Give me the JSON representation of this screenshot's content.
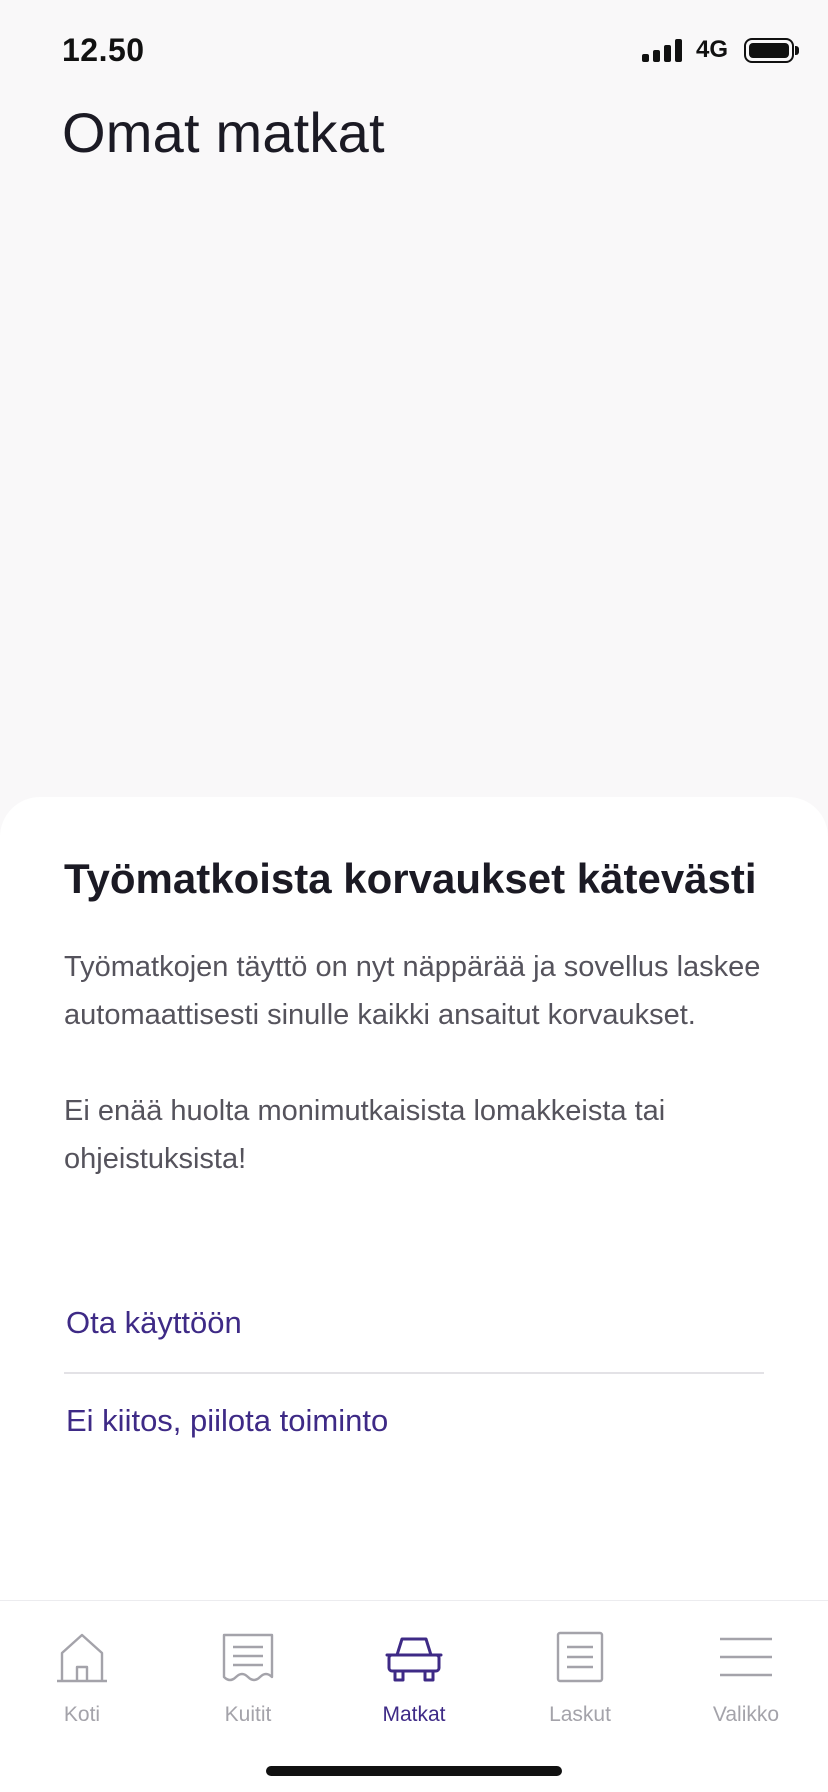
{
  "status_bar": {
    "time": "12.50",
    "network": "4G",
    "icons": [
      "signal-icon",
      "battery-icon"
    ]
  },
  "page": {
    "title": "Omat matkat"
  },
  "sheet": {
    "title": "Työmatkoista korvaukset kätevästi",
    "paragraph_1": "Työmatkojen täyttö on nyt näppärää ja sovellus laskee automaattisesti sinulle kaikki ansaitut korvaukset.",
    "paragraph_2": "Ei enää huolta monimutkaisista lomakkeista tai ohjeistuksista!",
    "enable_label": "Ota käyttöön",
    "hide_label": "Ei kiitos, piilota toiminto"
  },
  "tabs": [
    {
      "label": "Koti",
      "icon": "home-icon",
      "active": false
    },
    {
      "label": "Kuitit",
      "icon": "receipt-icon",
      "active": false
    },
    {
      "label": "Matkat",
      "icon": "car-icon",
      "active": true
    },
    {
      "label": "Laskut",
      "icon": "invoice-icon",
      "active": false
    },
    {
      "label": "Valikko",
      "icon": "menu-icon",
      "active": false
    }
  ],
  "colors": {
    "accent": "#3e2a86",
    "inactive": "#a4a3aa",
    "background": "#f9f8f9",
    "sheet": "#ffffff"
  }
}
